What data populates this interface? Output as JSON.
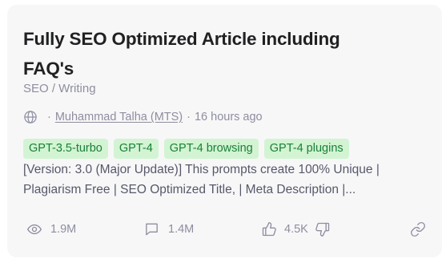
{
  "prompt": {
    "title": "Fully SEO Optimized Article including FAQ's",
    "category": "SEO / Writing",
    "separator": "·",
    "author": "Muhammad Talha (MTS)",
    "time_ago": "16 hours ago",
    "tags": [
      "GPT-3.5-turbo",
      "GPT-4",
      "GPT-4 browsing",
      "GPT-4 plugins"
    ],
    "description": "[Version: 3.0 (Major Update)] This prompts create 100% Unique | Plagiarism Free | SEO Optimized Title, | Meta Description |..."
  },
  "stats": {
    "views": "1.9M",
    "comments": "1.4M",
    "likes": "4.5K"
  },
  "icons": {
    "globe": "globe-icon",
    "views": "eye-icon",
    "comments": "comment-icon",
    "like": "thumbs-up-icon",
    "dislike": "thumbs-down-icon",
    "share": "link-icon"
  },
  "colors": {
    "card_bg": "#f7f7f8",
    "title": "#202123",
    "muted": "#8e8ea0",
    "tag_bg": "#d2f4d3",
    "tag_text": "#1a7f37"
  }
}
